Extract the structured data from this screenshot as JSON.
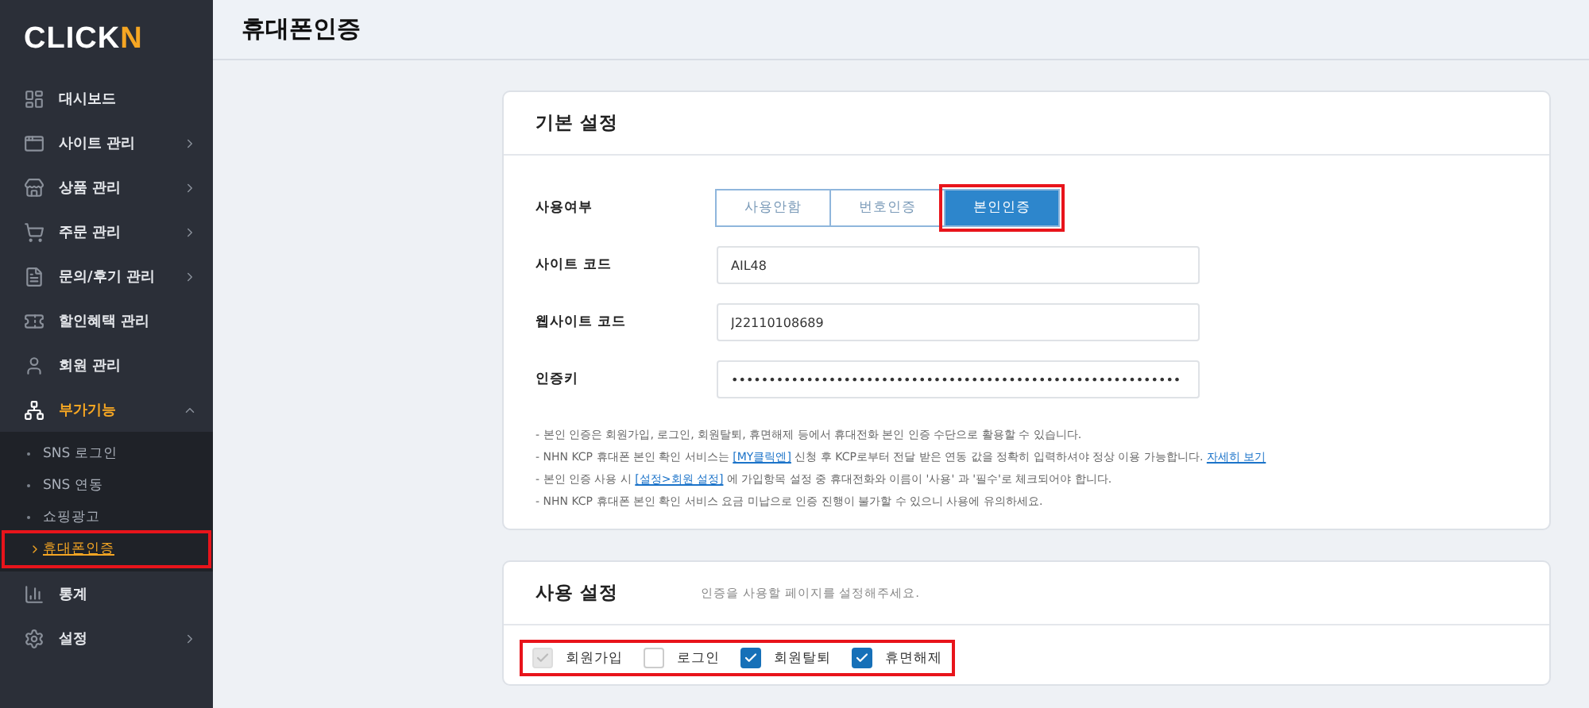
{
  "logo": {
    "text": "CLICK",
    "accent": "N"
  },
  "sidebar": {
    "items": [
      {
        "label": "대시보드",
        "has_submenu": false,
        "selected": false
      },
      {
        "label": "사이트 관리",
        "has_submenu": true,
        "expanded": false,
        "selected": false
      },
      {
        "label": "상품 관리",
        "has_submenu": true,
        "expanded": false,
        "selected": false
      },
      {
        "label": "주문 관리",
        "has_submenu": true,
        "expanded": false,
        "selected": false
      },
      {
        "label": "문의/후기 관리",
        "has_submenu": true,
        "expanded": false,
        "selected": false
      },
      {
        "label": "할인혜택 관리",
        "has_submenu": false,
        "selected": false
      },
      {
        "label": "회원 관리",
        "has_submenu": false,
        "selected": false
      },
      {
        "label": "부가기능",
        "has_submenu": true,
        "selected": true,
        "expanded": true,
        "children": [
          {
            "label": "SNS 로그인",
            "selected": false,
            "highlighted": false
          },
          {
            "label": "SNS 연동",
            "selected": false,
            "highlighted": false
          },
          {
            "label": "쇼핑광고",
            "selected": false,
            "highlighted": false
          },
          {
            "label": "휴대폰인증",
            "selected": true,
            "highlighted": true
          }
        ]
      },
      {
        "label": "통계",
        "has_submenu": false,
        "selected": false
      },
      {
        "label": "설정",
        "has_submenu": true,
        "expanded": false,
        "selected": false
      }
    ]
  },
  "page_title": "휴대폰인증",
  "basic_settings": {
    "title": "기본 설정",
    "usage": {
      "label": "사용여부",
      "options": [
        {
          "label": "사용안함",
          "selected": false,
          "highlighted": false
        },
        {
          "label": "번호인증",
          "selected": false,
          "highlighted": false
        },
        {
          "label": "본인인증",
          "selected": true,
          "highlighted": true
        }
      ]
    },
    "fields": [
      {
        "label": "사이트 코드",
        "value": "AIL48"
      },
      {
        "label": "웹사이트 코드",
        "value": "J22110108689"
      },
      {
        "label": "인증키",
        "value": "••••••••••••••••••••••••••••••••••••••••••••••••••••••••••••"
      }
    ],
    "notes": [
      [
        {
          "text": "- 본인 인증은 회원가입, 로그인, 회원탈퇴, 휴면해제 등에서 휴대전화 본인 인증 수단으로 활용할 수 있습니다."
        }
      ],
      [
        {
          "text": "- NHN KCP 휴대폰 본인 확인 서비스는 "
        },
        {
          "text": "[MY클릭엔]",
          "link": true
        },
        {
          "text": " 신청 후 KCP로부터 전달 받은 연동 값을 정확히 입력하셔야 정상 이용 가능합니다. "
        },
        {
          "text": "자세히 보기",
          "link": true
        }
      ],
      [
        {
          "text": "- 본인 인증 사용 시 "
        },
        {
          "text": "[설정>회원 설정]",
          "link": true
        },
        {
          "text": " 에 가입항목 설정 중 휴대전화와 이름이 '사용' 과 '필수'로 체크되어야 합니다."
        }
      ],
      [
        {
          "text": "- NHN KCP 휴대폰 본인 확인 서비스 요금 미납으로 인증 진행이 불가할 수 있으니 사용에 유의하세요."
        }
      ]
    ]
  },
  "usage_settings": {
    "title": "사용 설정",
    "description": "인증을 사용할 페이지를 설정해주세요.",
    "highlighted": true,
    "checkboxes": [
      {
        "label": "회원가입",
        "checked": true,
        "disabled": true
      },
      {
        "label": "로그인",
        "checked": false,
        "disabled": false
      },
      {
        "label": "회원탈퇴",
        "checked": true,
        "disabled": false
      },
      {
        "label": "휴면해제",
        "checked": true,
        "disabled": false
      }
    ]
  }
}
